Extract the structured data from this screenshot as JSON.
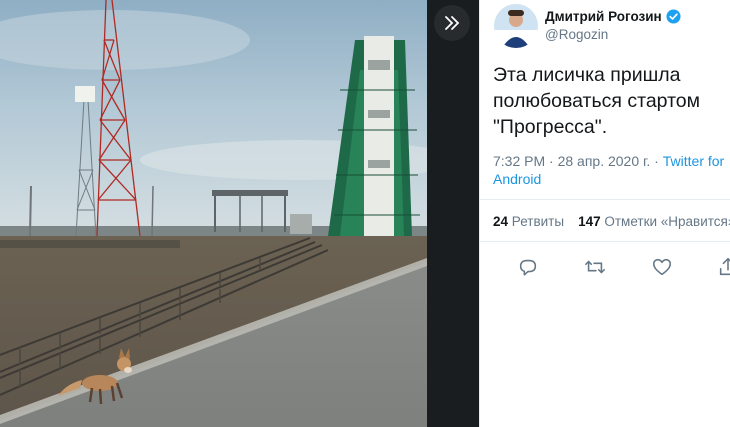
{
  "author": {
    "name": "Дмитрий Рогозин",
    "handle": "@Rogozin",
    "verified": true
  },
  "tweet": {
    "text": "Эта лисичка пришла полюбоваться стартом \"Прогресса\".",
    "time": "7:32 PM · 28 апр. 2020 г. · ",
    "source": "Twitter for Android"
  },
  "stats": {
    "retweets_count": "24",
    "retweets_label": "Ретвиты",
    "likes_count": "147",
    "likes_label": "Отметки «Нравится»"
  },
  "icons": {
    "expand": "double-chevron-right-icon",
    "reply": "reply-icon",
    "retweet": "retweet-icon",
    "like": "heart-icon",
    "share": "share-icon",
    "verified": "verified-badge-icon"
  },
  "colors": {
    "link": "#1b95e0",
    "verified": "#1da1f2",
    "muted": "#657786",
    "text": "#14171a"
  }
}
